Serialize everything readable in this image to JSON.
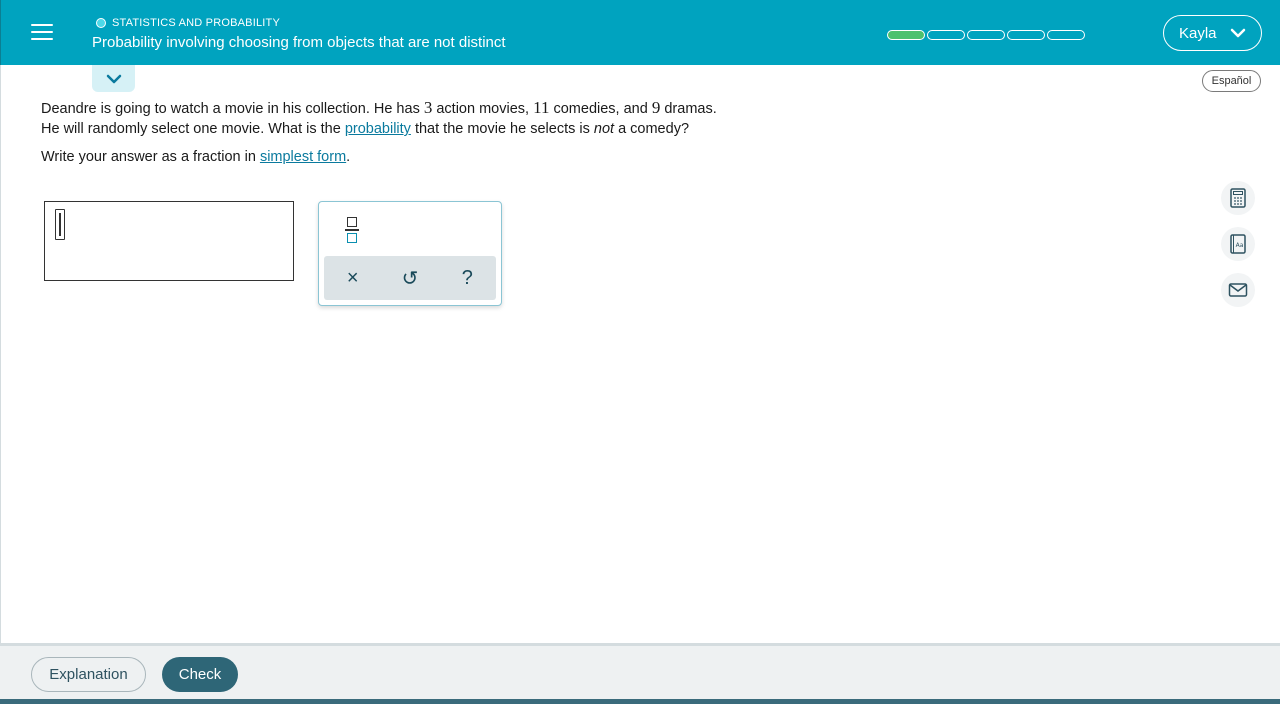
{
  "header": {
    "topic": "STATISTICS AND PROBABILITY",
    "title": "Probability involving choosing from objects that are not distinct",
    "progress": {
      "filled": 1,
      "total": 5
    },
    "user": "Kayla",
    "colors": {
      "bar": "#00a3bf",
      "progress_filled": "#4cc16e"
    }
  },
  "language_button": "Español",
  "question": {
    "p1": "Deandre is going to watch a movie in his collection. He has ",
    "n1": "3",
    "p2": " action movies, ",
    "n2": "11",
    "p3": " comedies, and ",
    "n3": "9",
    "p4": " dramas.",
    "line2_a": "He will randomly select one movie. What is the ",
    "link_probability": "probability",
    "line2_b": " that the movie he selects is ",
    "emph": "not",
    "line2_c": " a comedy?"
  },
  "instruction": {
    "text": "Write your answer as a fraction in ",
    "link": "simplest form",
    "end": "."
  },
  "answer": {
    "value": ""
  },
  "keypad": {
    "clear": "×",
    "undo": "↺",
    "help": "?"
  },
  "tools": [
    "calculator-icon",
    "dictionary-icon",
    "message-icon"
  ],
  "footer": {
    "explanation": "Explanation",
    "check": "Check"
  }
}
